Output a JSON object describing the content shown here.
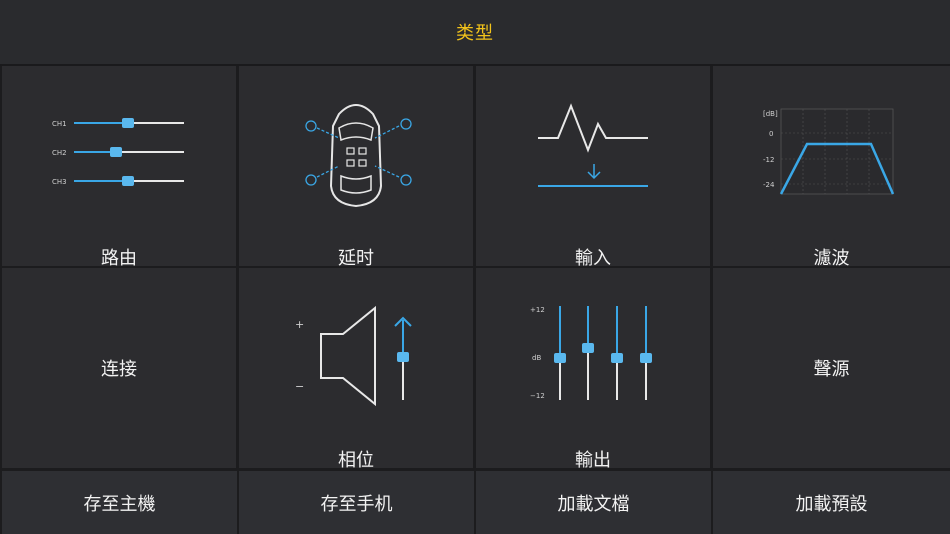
{
  "header": {
    "title": "类型"
  },
  "tiles": [
    {
      "label": "路由",
      "channels": [
        "CH1",
        "CH2",
        "CH3"
      ]
    },
    {
      "label": "延时"
    },
    {
      "label": "輸入"
    },
    {
      "label": "濾波",
      "axis": {
        "unit": "[dB]",
        "ticks": [
          "0",
          "-12",
          "-24"
        ]
      }
    },
    {
      "label": "连接"
    },
    {
      "label": "相位",
      "plus": "+",
      "minus": "−"
    },
    {
      "label": "輸出",
      "axis": {
        "unit": "dB",
        "top": "+12",
        "bottom": "−12"
      }
    },
    {
      "label": "聲源"
    }
  ],
  "buttons": [
    "存至主機",
    "存至手机",
    "加載文檔",
    "加載預設"
  ],
  "colors": {
    "accent": "#3aa7e6",
    "title": "#f2c31b",
    "tile_bg": "#2c2c2f"
  }
}
